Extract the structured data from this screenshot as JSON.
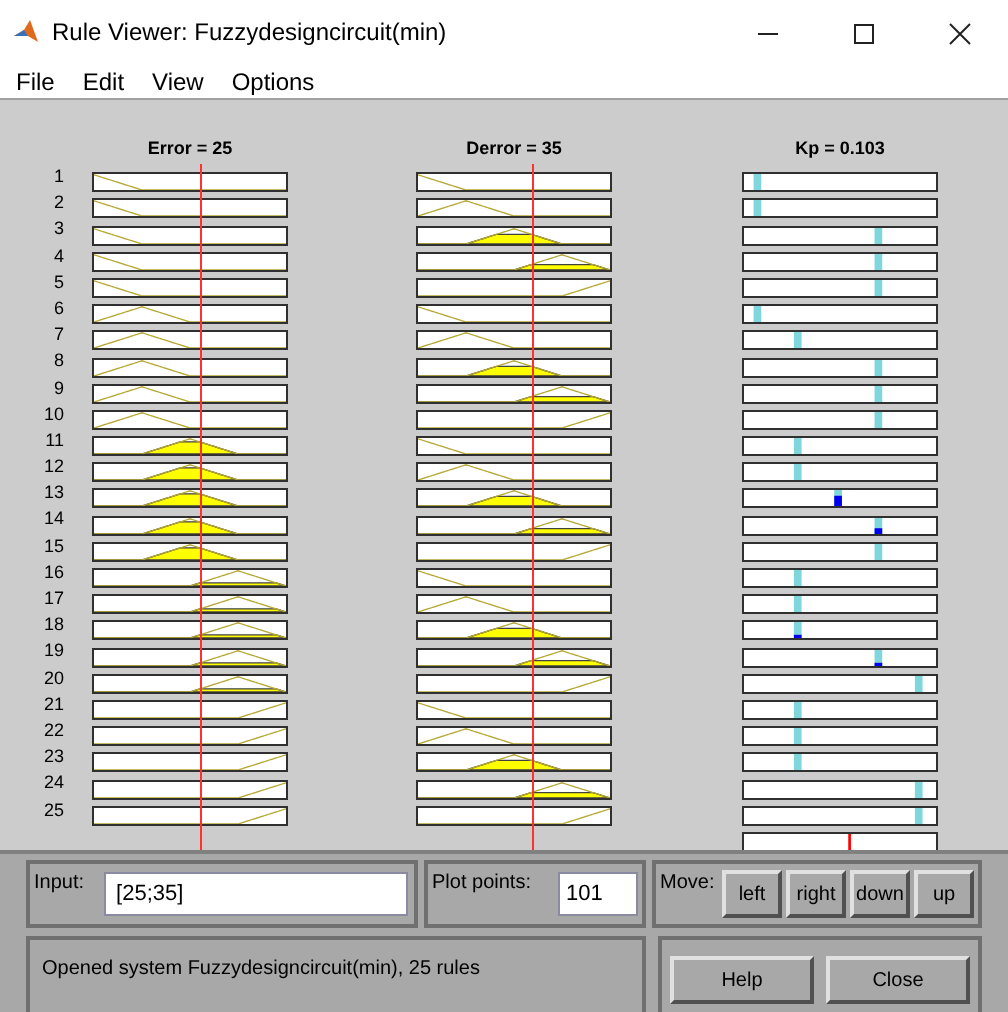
{
  "window": {
    "title": "Rule Viewer: Fuzzydesigncircuit(min)"
  },
  "menu": [
    "File",
    "Edit",
    "View",
    "Options"
  ],
  "inputs": [
    {
      "label": "Error = 25",
      "level": 0.55
    },
    {
      "label": "Derror = 35",
      "level": 0.59
    }
  ],
  "output": {
    "label": "Kp = 0.103",
    "level": 0.55
  },
  "rules": [
    {
      "number": "1",
      "error": {
        "kind": "leftshoulder"
      },
      "derror": {
        "kind": "leftshoulder"
      },
      "kp": {
        "kind": "farleft"
      }
    },
    {
      "number": "2",
      "error": {
        "kind": "leftshoulder"
      },
      "derror": {
        "kind": "left"
      },
      "kp": {
        "kind": "farleft"
      }
    },
    {
      "number": "3",
      "error": {
        "kind": "leftshoulder"
      },
      "derror": {
        "kind": "center"
      },
      "kp": {
        "kind": "right"
      }
    },
    {
      "number": "4",
      "error": {
        "kind": "leftshoulder"
      },
      "derror": {
        "kind": "right"
      },
      "kp": {
        "kind": "right"
      }
    },
    {
      "number": "5",
      "error": {
        "kind": "leftshoulder"
      },
      "derror": {
        "kind": "rightshoulder"
      },
      "kp": {
        "kind": "right"
      }
    },
    {
      "number": "6",
      "error": {
        "kind": "left"
      },
      "derror": {
        "kind": "leftshoulder"
      },
      "kp": {
        "kind": "farleft"
      }
    },
    {
      "number": "7",
      "error": {
        "kind": "left"
      },
      "derror": {
        "kind": "left"
      },
      "kp": {
        "kind": "left"
      }
    },
    {
      "number": "8",
      "error": {
        "kind": "left"
      },
      "derror": {
        "kind": "center"
      },
      "kp": {
        "kind": "right"
      }
    },
    {
      "number": "9",
      "error": {
        "kind": "left"
      },
      "derror": {
        "kind": "right"
      },
      "kp": {
        "kind": "right"
      }
    },
    {
      "number": "10",
      "error": {
        "kind": "left"
      },
      "derror": {
        "kind": "rightshoulder"
      },
      "kp": {
        "kind": "right"
      }
    },
    {
      "number": "11",
      "error": {
        "kind": "center"
      },
      "derror": {
        "kind": "leftshoulder"
      },
      "kp": {
        "kind": "left"
      }
    },
    {
      "number": "12",
      "error": {
        "kind": "center"
      },
      "derror": {
        "kind": "left"
      },
      "kp": {
        "kind": "left"
      }
    },
    {
      "number": "13",
      "error": {
        "kind": "center"
      },
      "derror": {
        "kind": "center"
      },
      "kp": {
        "kind": "center"
      }
    },
    {
      "number": "14",
      "error": {
        "kind": "center"
      },
      "derror": {
        "kind": "right"
      },
      "kp": {
        "kind": "right"
      }
    },
    {
      "number": "15",
      "error": {
        "kind": "center"
      },
      "derror": {
        "kind": "rightshoulder"
      },
      "kp": {
        "kind": "right"
      }
    },
    {
      "number": "16",
      "error": {
        "kind": "right"
      },
      "derror": {
        "kind": "leftshoulder"
      },
      "kp": {
        "kind": "left"
      }
    },
    {
      "number": "17",
      "error": {
        "kind": "right"
      },
      "derror": {
        "kind": "left"
      },
      "kp": {
        "kind": "left"
      }
    },
    {
      "number": "18",
      "error": {
        "kind": "right"
      },
      "derror": {
        "kind": "center"
      },
      "kp": {
        "kind": "left"
      }
    },
    {
      "number": "19",
      "error": {
        "kind": "right"
      },
      "derror": {
        "kind": "right"
      },
      "kp": {
        "kind": "right"
      }
    },
    {
      "number": "20",
      "error": {
        "kind": "right"
      },
      "derror": {
        "kind": "rightshoulder"
      },
      "kp": {
        "kind": "farright"
      }
    },
    {
      "number": "21",
      "error": {
        "kind": "rightshoulder"
      },
      "derror": {
        "kind": "leftshoulder"
      },
      "kp": {
        "kind": "left"
      }
    },
    {
      "number": "22",
      "error": {
        "kind": "rightshoulder"
      },
      "derror": {
        "kind": "left"
      },
      "kp": {
        "kind": "left"
      }
    },
    {
      "number": "23",
      "error": {
        "kind": "rightshoulder"
      },
      "derror": {
        "kind": "center"
      },
      "kp": {
        "kind": "left"
      }
    },
    {
      "number": "24",
      "error": {
        "kind": "rightshoulder"
      },
      "derror": {
        "kind": "right"
      },
      "kp": {
        "kind": "farright"
      }
    },
    {
      "number": "25",
      "error": {
        "kind": "rightshoulder"
      },
      "derror": {
        "kind": "rightshoulder"
      },
      "kp": {
        "kind": "farright"
      }
    }
  ],
  "input_panel": {
    "label": "Input:",
    "value": "[25;35]"
  },
  "plot_points": {
    "label": "Plot points:",
    "value": "101"
  },
  "move": {
    "label": "Move:",
    "buttons": [
      "left",
      "right",
      "down",
      "up"
    ]
  },
  "status": "Opened system Fuzzydesigncircuit(min), 25 rules",
  "buttons": [
    "Help",
    "Close"
  ]
}
